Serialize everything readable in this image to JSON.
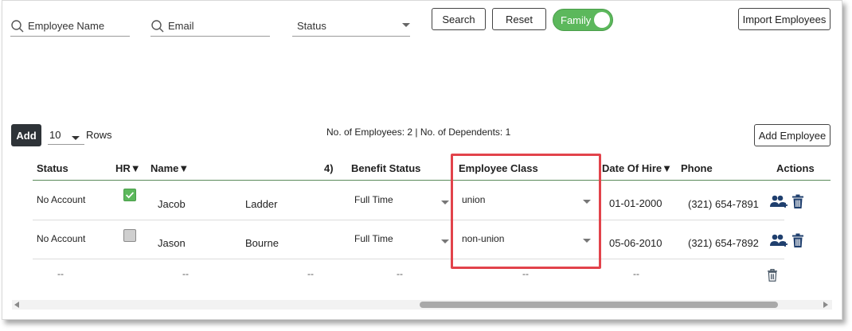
{
  "filters": {
    "name_placeholder": "Employee Name",
    "email_placeholder": "Email",
    "status_placeholder": "Status"
  },
  "buttons": {
    "search": "Search",
    "reset": "Reset",
    "family": "Family",
    "import": "Import Employees",
    "add": "Add",
    "add_employee": "Add Employee"
  },
  "toolbar": {
    "rows_value": "10",
    "rows_label": "Rows",
    "counts": "No. of Employees: 2 | No. of Dependents: 1"
  },
  "table": {
    "headers": {
      "status": "Status",
      "hr": "HR▼",
      "name": "Name▼",
      "col4": "4)",
      "benefit_status": "Benefit Status",
      "employee_class": "Employee Class",
      "date_of_hire": "Date Of Hire▼",
      "phone": "Phone",
      "actions": "Actions"
    },
    "rows": [
      {
        "status": "No Account",
        "hr_checked": true,
        "first_name": "Jacob",
        "last_name": "Ladder",
        "benefit_status": "Full Time",
        "employee_class": "union",
        "date_of_hire": "01-01-2000",
        "phone": "(321) 654-7891"
      },
      {
        "status": "No Account",
        "hr_checked": false,
        "first_name": "Jason",
        "last_name": "Bourne",
        "benefit_status": "Full Time",
        "employee_class": "non-union",
        "date_of_hire": "05-06-2010",
        "phone": "(321) 654-7892"
      }
    ],
    "empty_row_placeholder": "--"
  },
  "icons": {
    "search": "search-icon",
    "caret": "chevron-down-icon",
    "dependents": "add-dependent-icon",
    "delete": "trash-icon"
  },
  "colors": {
    "accent_green": "#5cb85c",
    "dark_button": "#2e3338",
    "highlight_red": "#e2434b"
  }
}
